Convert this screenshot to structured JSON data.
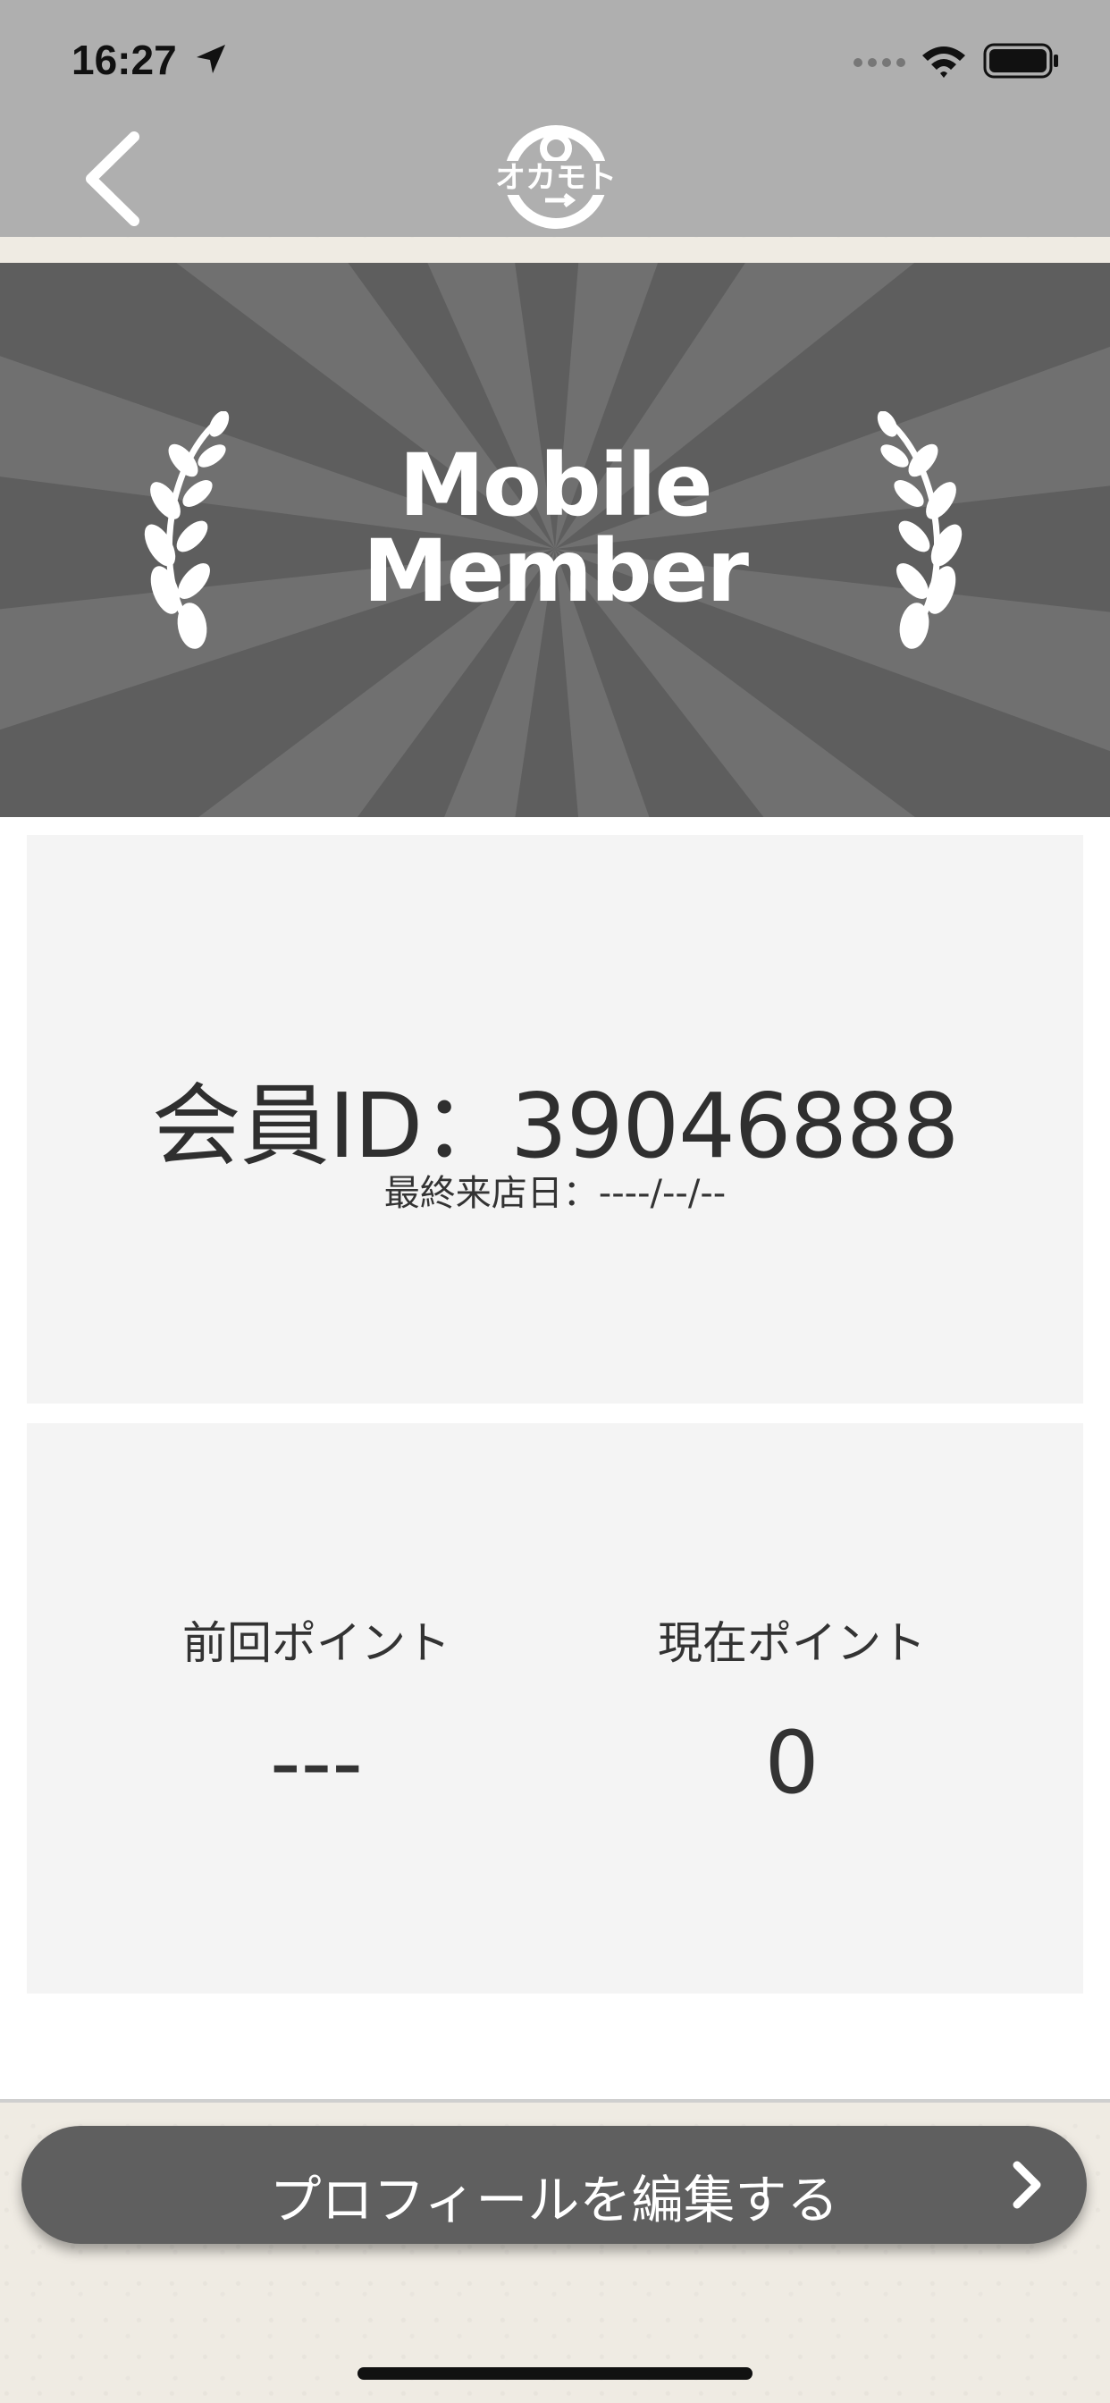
{
  "status_bar": {
    "time": "16:27"
  },
  "nav": {
    "logo_text": "オカモト"
  },
  "hero": {
    "line1": "Mobile",
    "line2": "Member"
  },
  "member_card": {
    "member_id": "会員ID：39046888",
    "last_visit": "最終来店日：----/--/--"
  },
  "points_card": {
    "previous_label": "前回ポイント",
    "previous_value": "---",
    "current_label": "現在ポイント",
    "current_value": "0"
  },
  "edit_profile": {
    "label": "プロフィールを編集する"
  },
  "colors": {
    "bar_gray": "#afafaf",
    "hero_dark": "#5e5e5e",
    "hero_ray": "#707070",
    "button": "#5f5f5f",
    "card": "#f4f4f4"
  }
}
